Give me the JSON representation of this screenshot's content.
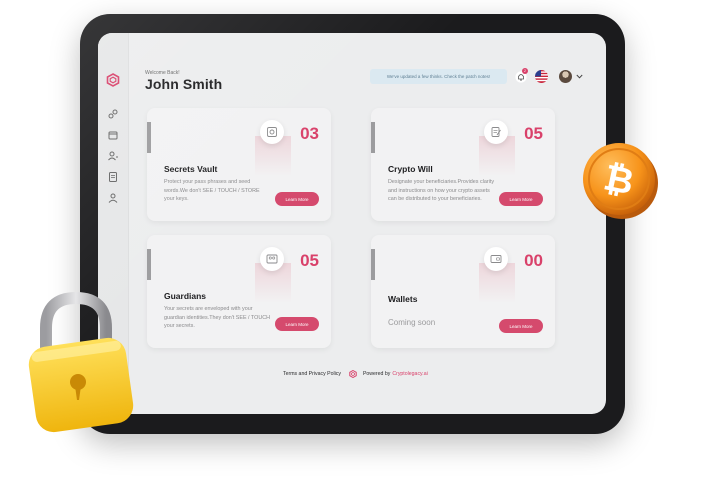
{
  "header": {
    "welcome": "Welcome Back!",
    "user_name": "John Smith",
    "notice": "We've updated a few thinks. Check the patch notes!",
    "notification_count": "2"
  },
  "sidebar": {
    "items": [
      {
        "icon": "home-icon"
      },
      {
        "icon": "folder-icon"
      },
      {
        "icon": "user-add-icon"
      },
      {
        "icon": "document-icon"
      },
      {
        "icon": "user-icon"
      }
    ]
  },
  "cards": [
    {
      "title": "Secrets Vault",
      "count": "03",
      "icon": "vault-icon",
      "desc": [
        "Protect your pass phrases and seed",
        "words.We don't SEE / TOUCH / STORE",
        "your keys."
      ],
      "button": "Learn More"
    },
    {
      "title": "Crypto Will",
      "count": "05",
      "icon": "will-document-icon",
      "desc": [
        "Designate your beneficiaries.Provides clarity",
        "and instructions on how your crypto assets",
        "can be distributed to your beneficiaries."
      ],
      "button": "Learn More"
    },
    {
      "title": "Guardians",
      "count": "05",
      "icon": "guardians-icon",
      "desc": [
        "Your secrets are enveloped with your",
        "guardian identities.They don't SEE / TOUCH",
        "your secrets."
      ],
      "button": "Learn More"
    },
    {
      "title": "Wallets",
      "count": "00",
      "icon": "wallet-icon",
      "status": "Coming soon",
      "button": "Learn More"
    }
  ],
  "footer": {
    "terms": "Terms and Privacy Policy",
    "powered_by": "Powered by",
    "brand": "Cryptolegacy.ai"
  },
  "colors": {
    "accent": "#d9416a",
    "button": "#d54a6d",
    "bitcoin": "#f7931a",
    "lock": "#f5c51c"
  }
}
